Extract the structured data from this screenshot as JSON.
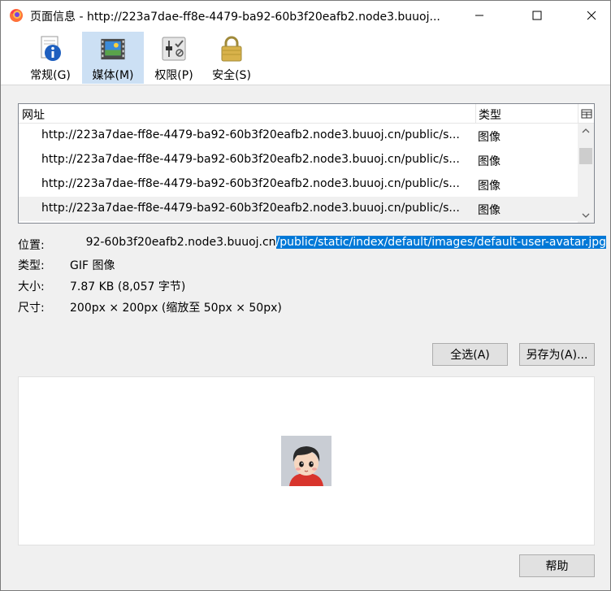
{
  "window": {
    "title": "页面信息 - http://223a7dae-ff8e-4479-ba92-60b3f20eafb2.node3.buuoj...",
    "app_icon": "firefox-icon",
    "controls": {
      "minimize": "minimize-icon",
      "maximize": "maximize-icon",
      "close": "close-icon"
    }
  },
  "toolbar": {
    "items": [
      {
        "label": "常规(G)",
        "icon": "info-icon"
      },
      {
        "label": "媒体(M)",
        "icon": "media-icon",
        "selected": true
      },
      {
        "label": "权限(P)",
        "icon": "permissions-icon"
      },
      {
        "label": "安全(S)",
        "icon": "lock-icon"
      }
    ]
  },
  "media_list": {
    "columns": {
      "url": "网址",
      "type": "类型"
    },
    "rows": [
      {
        "url": "http://223a7dae-ff8e-4479-ba92-60b3f20eafb2.node3.buuoj.cn/public/s...",
        "type": "图像"
      },
      {
        "url": "http://223a7dae-ff8e-4479-ba92-60b3f20eafb2.node3.buuoj.cn/public/s...",
        "type": "图像"
      },
      {
        "url": "http://223a7dae-ff8e-4479-ba92-60b3f20eafb2.node3.buuoj.cn/public/s...",
        "type": "图像"
      },
      {
        "url": "http://223a7dae-ff8e-4479-ba92-60b3f20eafb2.node3.buuoj.cn/public/s...",
        "type": "图像"
      }
    ]
  },
  "details": {
    "location_label": "位置:",
    "location_unselected": "92-60b3f20eafb2.node3.buuoj.cn",
    "location_selected": "/public/static/index/default/images/default-user-avatar.jpg",
    "type_label": "类型:",
    "type_value": "GIF 图像",
    "size_label": "大小:",
    "size_value": "7.87 KB (8,057 字节)",
    "dimensions_label": "尺寸:",
    "dimensions_value": "200px × 200px (缩放至 50px × 50px)"
  },
  "buttons": {
    "select_all": "全选(A)",
    "save_as": "另存为(A)...",
    "help": "帮助"
  },
  "colors": {
    "selection": "#0078d7",
    "toolbar_selected": "#cce0f4"
  }
}
